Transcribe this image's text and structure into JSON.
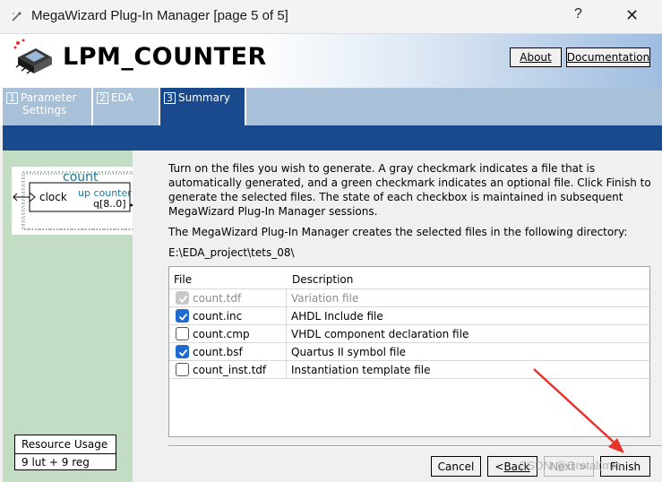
{
  "window": {
    "title": "MegaWizard Plug-In Manager [page 5 of 5]",
    "help_glyph": "?",
    "close_glyph": "✕",
    "icon": "wand-icon"
  },
  "header": {
    "title": "LPM_COUNTER",
    "logo_icon": "chip-icon",
    "about_label": "About",
    "documentation_label": "Documentation"
  },
  "tabs": [
    {
      "num": "1",
      "label": "Parameter",
      "label2": "Settings",
      "active": false
    },
    {
      "num": "2",
      "label": "EDA",
      "active": false
    },
    {
      "num": "3",
      "label": "Summary",
      "active": true
    }
  ],
  "symbol": {
    "name": "count",
    "input_port": "clock",
    "type_label": "up counter",
    "output_port": "q[8..0]"
  },
  "resource_usage": {
    "heading": "Resource Usage",
    "value": "9 lut + 9 reg"
  },
  "content": {
    "description": "Turn on the files you wish to generate. A gray checkmark indicates a file that is automatically generated, and a green checkmark indicates an optional file. Click Finish to generate the selected files. The state of each checkbox is maintained in subsequent MegaWizard Plug-In Manager sessions.",
    "directory_intro": "The MegaWizard Plug-In Manager creates the selected files in the following directory:",
    "directory": "E:\\EDA_project\\tets_08\\"
  },
  "file_table": {
    "columns": [
      "File",
      "Description"
    ],
    "rows": [
      {
        "file": "count.tdf",
        "description": "Variation file",
        "checked": true,
        "disabled": true
      },
      {
        "file": "count.inc",
        "description": "AHDL Include file",
        "checked": true,
        "disabled": false
      },
      {
        "file": "count.cmp",
        "description": "VHDL component declaration file",
        "checked": false,
        "disabled": false
      },
      {
        "file": "count.bsf",
        "description": "Quartus II symbol file",
        "checked": true,
        "disabled": false
      },
      {
        "file": "count_inst.tdf",
        "description": "Instantiation template file",
        "checked": false,
        "disabled": false
      }
    ]
  },
  "footer": {
    "cancel_label": "Cancel",
    "back_prefix": "< ",
    "back_label": "Back",
    "next_label": "Next >",
    "finish_label": "Finish"
  },
  "watermark": "CSDN @Gretal(mie",
  "colors": {
    "tab_active": "#194a8d",
    "tab_inactive": "#a9c0d9",
    "left_panel": "#c2ddc3",
    "checkbox_checked": "#1e6ad2",
    "annotation_arrow": "#e8332b"
  }
}
